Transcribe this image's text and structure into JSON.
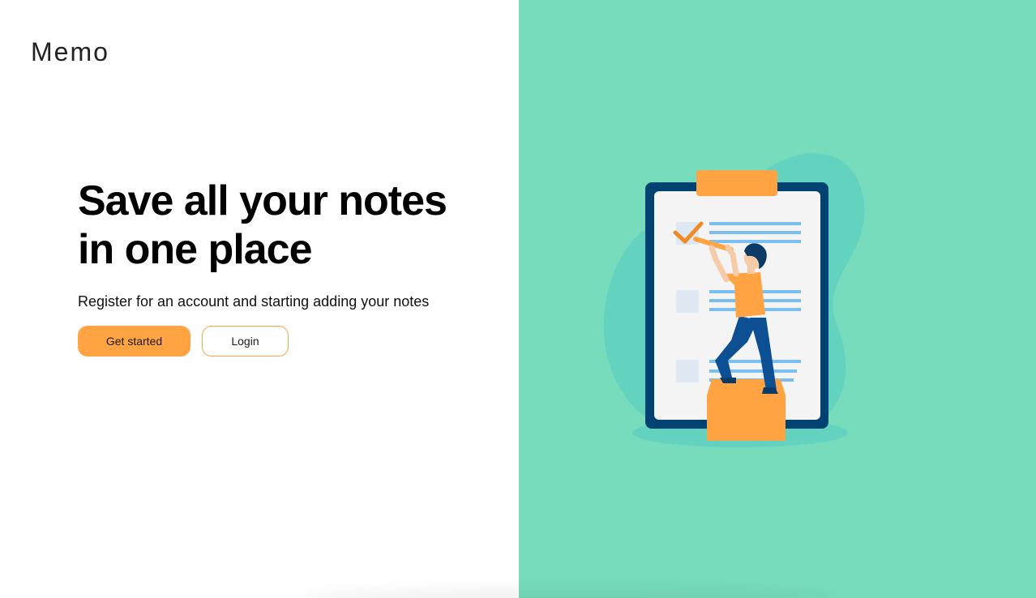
{
  "brand": {
    "name": "Memo"
  },
  "hero": {
    "headline_line1": "Save all your notes",
    "headline_line2": "in one place",
    "subtitle": "Register for an account and starting adding your notes"
  },
  "actions": {
    "primary_label": "Get started",
    "secondary_label": "Login"
  },
  "illustration": {
    "icon": "clipboard-checklist-illustration",
    "colors": {
      "panel_bg": "#76dcbb",
      "blob": "#63d3bf",
      "clipboard_frame": "#004372",
      "clipboard_paper": "#f4f4f4",
      "accent_orange": "#ffa343",
      "line_blue": "#7bbef0",
      "checkbox": "#dde8f2",
      "trousers": "#0d4f93",
      "hair": "#0a3a66",
      "skin": "#f6cba7"
    }
  },
  "colors": {
    "accent": "#ffa343",
    "text": "#000000",
    "background": "#ffffff"
  }
}
